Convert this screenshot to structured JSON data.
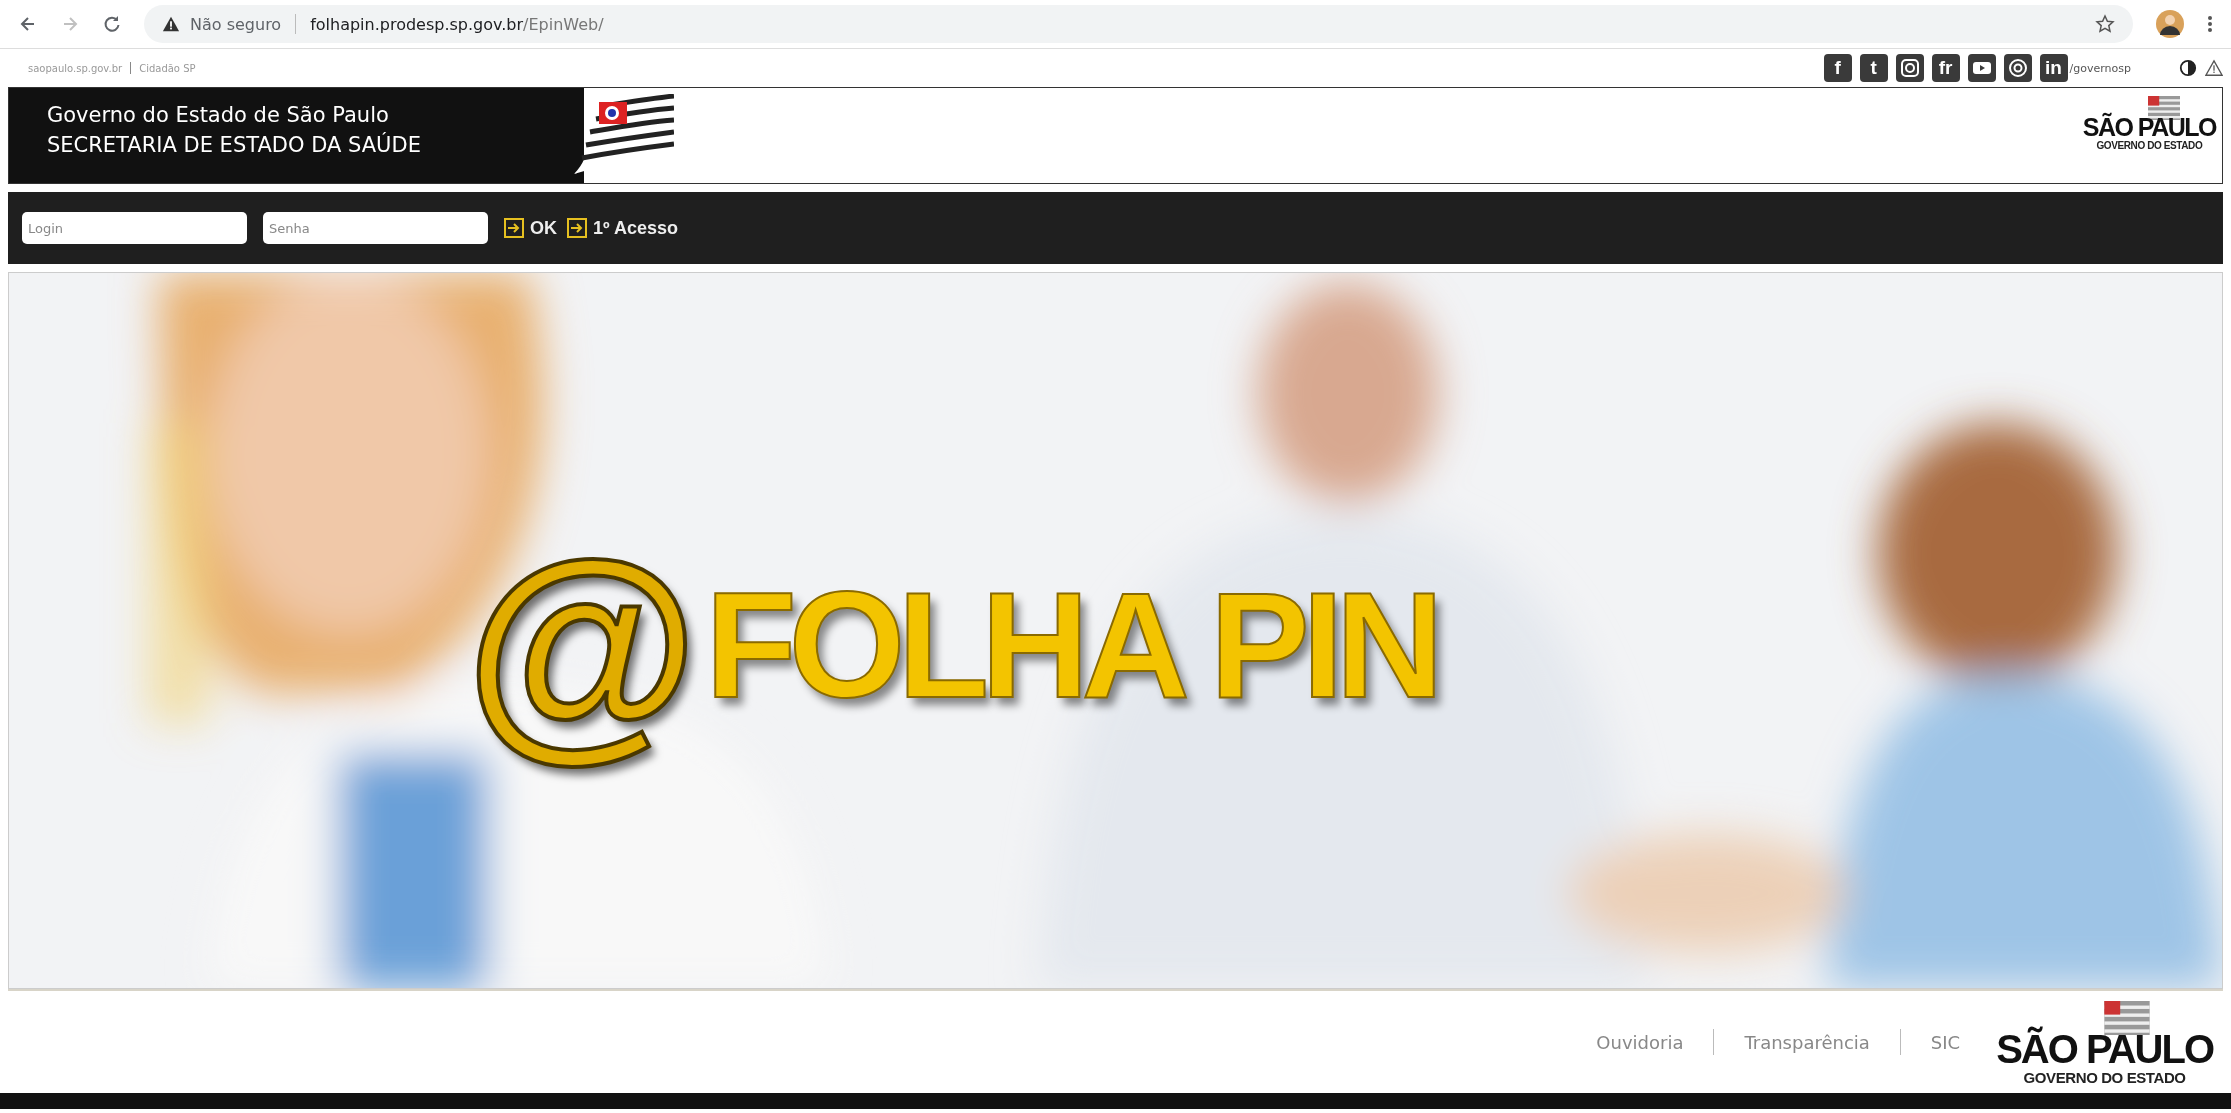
{
  "browser": {
    "security": "Não seguro",
    "url_host": "folhapin.prodesp.sp.gov.br",
    "url_path": "/EpinWeb/"
  },
  "top_links": [
    "saopaulo.sp.gov.br",
    "Cidadão SP"
  ],
  "social": [
    {
      "kind": "letter",
      "label": "f"
    },
    {
      "kind": "letter",
      "label": "t"
    },
    {
      "kind": "camera"
    },
    {
      "kind": "letter",
      "label": "fr"
    },
    {
      "kind": "play"
    },
    {
      "kind": "target"
    },
    {
      "kind": "letter",
      "label": "in"
    }
  ],
  "social_handle": "/governosp",
  "header": {
    "line1": "Governo do Estado de São Paulo",
    "line2": "SECRETARIA DE ESTADO DA SAÚDE",
    "logo_title": "SÃO PAULO",
    "logo_sub": "GOVERNO DO ESTADO"
  },
  "login": {
    "login_placeholder": "Login",
    "password_placeholder": "Senha",
    "actions": [
      "OK",
      "1º Acesso"
    ]
  },
  "hero": {
    "kind": "picture",
    "at": "@",
    "title": "FOLHA PIN"
  },
  "footer": {
    "links": [
      "Ouvidoria",
      "Transparência",
      "SIC"
    ],
    "logo_title": "SÃO PAULO",
    "logo_sub": "GOVERNO DO ESTADO"
  }
}
